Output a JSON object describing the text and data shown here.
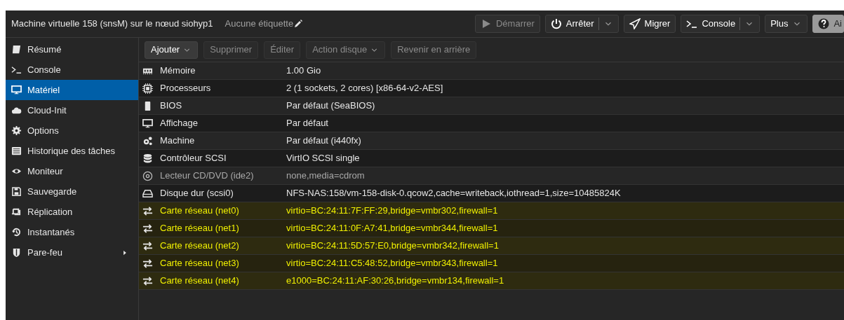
{
  "header": {
    "title": "Machine virtuelle 158 (snsM) sur le nœud siohyp1",
    "tags": "Aucune étiquette",
    "buttons": [
      {
        "label": "Démarrer",
        "disabled": true,
        "split": false,
        "kind": "play"
      },
      {
        "label": "Arrêter",
        "disabled": false,
        "split": true,
        "kind": "power"
      },
      {
        "label": "Migrer",
        "disabled": false,
        "split": false,
        "kind": "send"
      },
      {
        "label": "Console",
        "disabled": false,
        "split": true,
        "kind": "terminal"
      },
      {
        "label": "Plus",
        "disabled": false,
        "split": false,
        "kind": "menu"
      },
      {
        "label": "Ai",
        "disabled": false,
        "split": false,
        "kind": "help"
      }
    ]
  },
  "sidebar": {
    "items": [
      {
        "label": "Résumé",
        "selected": false
      },
      {
        "label": "Console",
        "selected": false
      },
      {
        "label": "Matériel",
        "selected": true
      },
      {
        "label": "Cloud-Init",
        "selected": false
      },
      {
        "label": "Options",
        "selected": false
      },
      {
        "label": "Historique des tâches",
        "selected": false
      },
      {
        "label": "Moniteur",
        "selected": false
      },
      {
        "label": "Sauvegarde",
        "selected": false
      },
      {
        "label": "Réplication",
        "selected": false
      },
      {
        "label": "Instantanés",
        "selected": false
      },
      {
        "label": "Pare-feu",
        "selected": false,
        "submenu": true
      }
    ]
  },
  "toolbar": [
    {
      "label": "Ajouter",
      "disabled": false,
      "dropdown": true
    },
    {
      "label": "Supprimer",
      "disabled": true,
      "dropdown": false
    },
    {
      "label": "Éditer",
      "disabled": true,
      "dropdown": false
    },
    {
      "label": "Action disque",
      "disabled": true,
      "dropdown": true
    },
    {
      "label": "Revenir en arrière",
      "disabled": true,
      "dropdown": false
    }
  ],
  "table": {
    "rows": [
      {
        "name": "Mémoire",
        "value": "1.00 Gio",
        "disabled": false,
        "highlighted": false
      },
      {
        "name": "Processeurs",
        "value": "2 (1 sockets, 2 cores) [x86-64-v2-AES]",
        "disabled": false,
        "highlighted": false
      },
      {
        "name": "BIOS",
        "value": "Par défaut (SeaBIOS)",
        "disabled": false,
        "highlighted": false
      },
      {
        "name": "Affichage",
        "value": "Par défaut",
        "disabled": false,
        "highlighted": false
      },
      {
        "name": "Machine",
        "value": "Par défaut (i440fx)",
        "disabled": false,
        "highlighted": false
      },
      {
        "name": "Contrôleur SCSI",
        "value": "VirtIO SCSI single",
        "disabled": false,
        "highlighted": false
      },
      {
        "name": "Lecteur CD/DVD (ide2)",
        "value": "none,media=cdrom",
        "disabled": true,
        "highlighted": false
      },
      {
        "name": "Disque dur (scsi0)",
        "value": "NFS-NAS:158/vm-158-disk-0.qcow2,cache=writeback,iothread=1,size=10485824K",
        "disabled": false,
        "highlighted": false
      },
      {
        "name": "Carte réseau (net0)",
        "value": "virtio=BC:24:11:7F:FF:29,bridge=vmbr302,firewall=1",
        "disabled": false,
        "highlighted": true
      },
      {
        "name": "Carte réseau (net1)",
        "value": "virtio=BC:24:11:0F:A7:41,bridge=vmbr344,firewall=1",
        "disabled": false,
        "highlighted": true
      },
      {
        "name": "Carte réseau (net2)",
        "value": "virtio=BC:24:11:5D:57:E0,bridge=vmbr342,firewall=1",
        "disabled": false,
        "highlighted": true
      },
      {
        "name": "Carte réseau (net3)",
        "value": "virtio=BC:24:11:C5:48:52,bridge=vmbr343,firewall=1",
        "disabled": false,
        "highlighted": true
      },
      {
        "name": "Carte réseau (net4)",
        "value": "e1000=BC:24:11:AF:30:26,bridge=vmbr134,firewall=1",
        "disabled": false,
        "highlighted": true
      }
    ]
  }
}
